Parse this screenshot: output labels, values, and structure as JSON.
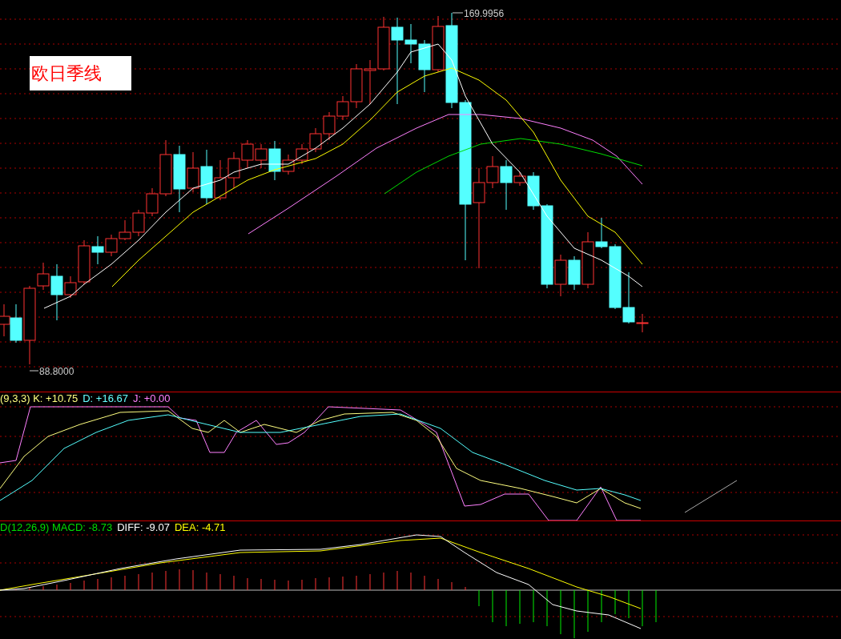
{
  "title": "欧日季线",
  "price_chart": {
    "high_label": "169.9956",
    "low_label": "88.8000"
  },
  "kdj": {
    "legend": [
      {
        "text": "(9,3,3) K: +10.75",
        "kind": "k"
      },
      {
        "text": "D: +16.67",
        "kind": "d"
      },
      {
        "text": "J: +0.00",
        "kind": "j"
      }
    ]
  },
  "macd": {
    "legend": [
      {
        "text": "D(12,26,9) MACD: -8.73",
        "kind": "macd"
      },
      {
        "text": "DIFF: -9.07",
        "kind": "diff"
      },
      {
        "text": "DEA: -4.71",
        "kind": "dea"
      }
    ]
  }
}
